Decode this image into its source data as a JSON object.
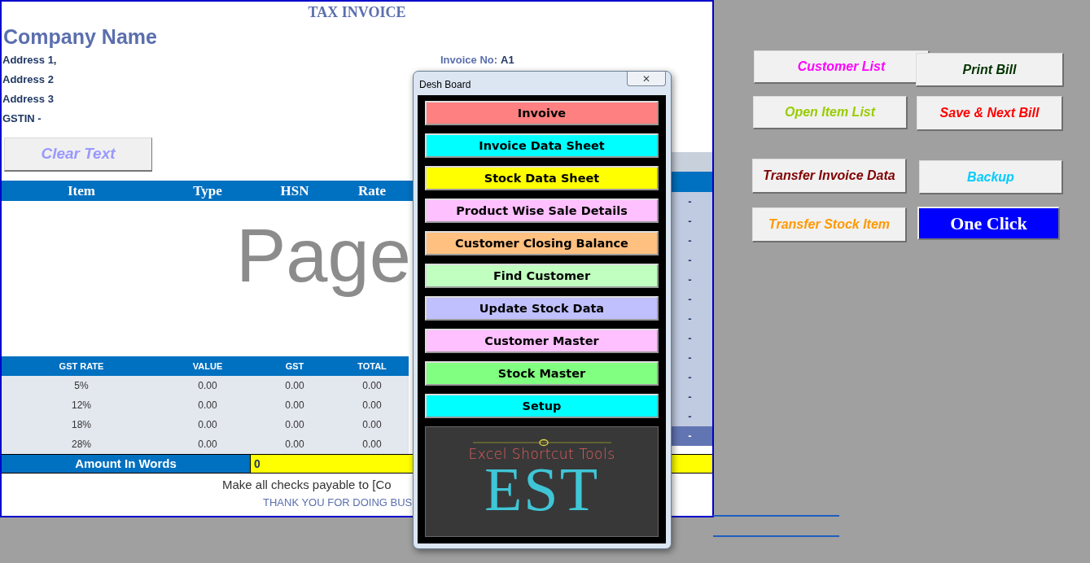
{
  "sheet": {
    "title": "TAX INVOICE",
    "company_name": "Company Name",
    "address_lines": [
      "Address 1,",
      "Address 2",
      "Address 3",
      "GSTIN -"
    ],
    "invoice_no_label": "Invoice No:",
    "invoice_no": "A1",
    "clear_button": "Clear Text",
    "items_header": [
      "Item",
      "Type",
      "HSN",
      "Rate"
    ],
    "watermark": "Page",
    "side_column": [
      {
        "text": "-",
        "highlighted": false
      },
      {
        "text": "-",
        "highlighted": false
      },
      {
        "text": "-",
        "highlighted": false
      },
      {
        "text": "-",
        "highlighted": false
      },
      {
        "text": "-",
        "highlighted": false
      },
      {
        "text": "-",
        "highlighted": false
      },
      {
        "text": "-",
        "highlighted": false
      },
      {
        "text": "-",
        "highlighted": false
      },
      {
        "text": "-",
        "highlighted": false
      },
      {
        "text": "-",
        "highlighted": false
      },
      {
        "text": "-",
        "highlighted": false
      },
      {
        "text": "-",
        "highlighted": false
      },
      {
        "text": "-",
        "highlighted": true
      }
    ],
    "gst_table": {
      "columns": [
        "GST RATE",
        "VALUE",
        "GST",
        "TOTAL"
      ],
      "rows": [
        [
          "5%",
          "0.00",
          "0.00",
          "0.00"
        ],
        [
          "12%",
          "0.00",
          "0.00",
          "0.00"
        ],
        [
          "18%",
          "0.00",
          "0.00",
          "0.00"
        ],
        [
          "28%",
          "0.00",
          "0.00",
          "0.00"
        ]
      ]
    },
    "amount_in_words": {
      "label": "Amount In Words",
      "value": "0"
    },
    "footer": [
      "Make all checks payable to [Co",
      "THANK YOU FOR DOING BUS"
    ]
  },
  "dialog": {
    "title": "Desh Board",
    "close": "✕",
    "buttons": [
      {
        "label": "Invoive",
        "color": "#ff8080"
      },
      {
        "label": "Invoice Data Sheet",
        "color": "#00ffff"
      },
      {
        "label": "Stock Data Sheet",
        "color": "#ffff00"
      },
      {
        "label": "Product Wise Sale Details",
        "color": "#ffc0ff"
      },
      {
        "label": "Customer Closing Balance",
        "color": "#ffc080"
      },
      {
        "label": "Find Customer",
        "color": "#c0ffc0"
      },
      {
        "label": "Update Stock Data",
        "color": "#c0c0ff"
      },
      {
        "label": "Customer Master",
        "color": "#ffc0ff"
      },
      {
        "label": "Stock Master",
        "color": "#80ff80"
      },
      {
        "label": "Setup",
        "color": "#00ffff"
      }
    ],
    "logo": {
      "tagline": "Excel Shortcut Tools",
      "mark": "EST"
    }
  },
  "buttons": [
    {
      "label": "Customer List",
      "kind": "outline",
      "color": "#ff00ff"
    },
    {
      "label": "Print Bill",
      "kind": "outline",
      "color": "#003300"
    },
    {
      "label": "Open Item List",
      "kind": "outline",
      "color": "#99cc00"
    },
    {
      "label": "Save & Next Bill",
      "kind": "outline",
      "color": "#ff0000"
    },
    {
      "label": "Transfer Invoice Data",
      "kind": "outline",
      "color": "#800000"
    },
    {
      "label": "Backup",
      "kind": "outline",
      "color": "#00ccff"
    },
    {
      "label": "Transfer Stock Item",
      "kind": "outline",
      "color": "#ff9900"
    },
    {
      "label": "One Click",
      "kind": "filled",
      "color": "#0000ff"
    }
  ]
}
